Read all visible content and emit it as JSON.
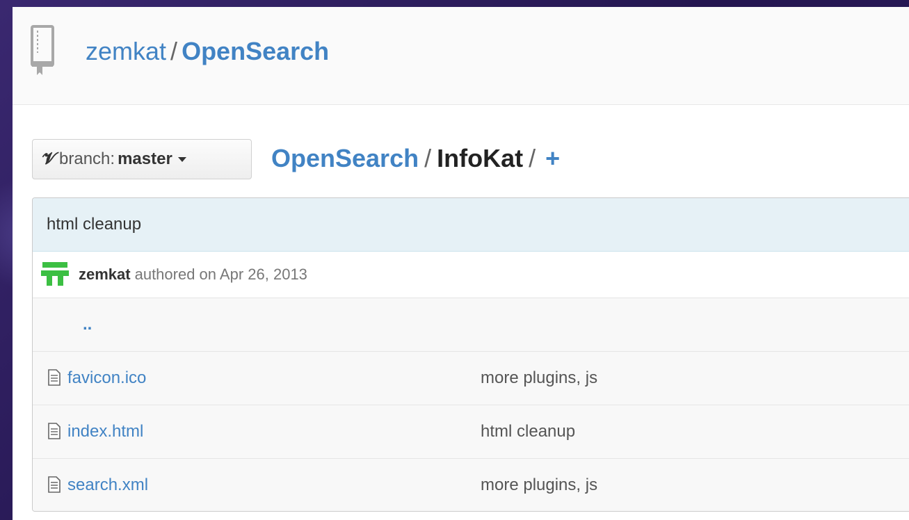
{
  "repo": {
    "owner": "zemkat",
    "separator": "/",
    "name": "OpenSearch"
  },
  "branch": {
    "label": "branch:",
    "name": "master"
  },
  "breadcrumb": {
    "root": "OpenSearch",
    "separator": "/",
    "current": "InfoKat",
    "separator2": "/",
    "add": "+"
  },
  "commit": {
    "message": "html cleanup",
    "author": "zemkat",
    "meta": "authored on Apr 26, 2013"
  },
  "files": {
    "up_link": "..",
    "rows": [
      {
        "name": "favicon.ico",
        "message": "more plugins, js"
      },
      {
        "name": "index.html",
        "message": "html cleanup"
      },
      {
        "name": "search.xml",
        "message": "more plugins, js"
      }
    ]
  },
  "colors": {
    "link": "#4183c4",
    "commit_bar": "#e6f1f6",
    "avatar": "#3cbf43"
  }
}
